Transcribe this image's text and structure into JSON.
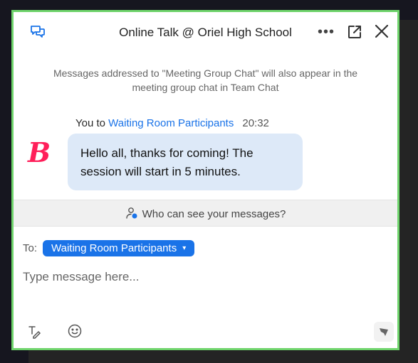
{
  "header": {
    "title": "Online Talk @ Oriel High School",
    "more_label": "•••"
  },
  "notice": "Messages addressed to \"Meeting Group Chat\" will also appear in the meeting group chat in Team Chat",
  "message": {
    "sender": "You to ",
    "recipient": "Waiting Room Participants",
    "time": "20:32",
    "avatar_letter": "B",
    "text": "Hello all, thanks for coming! The session will start in 5 minutes."
  },
  "visibility": {
    "label": "Who can see your messages?"
  },
  "composer": {
    "to_label": "To:",
    "recipient": "Waiting Room Participants",
    "caret": "▾",
    "placeholder": "Type message here..."
  },
  "colors": {
    "accent": "#1a73e8",
    "border": "#6fd46c",
    "avatar": "#ff1f5a",
    "bubble": "#dde9f8"
  },
  "icons": [
    "chat-bubbles-icon",
    "more-icon",
    "popout-icon",
    "close-icon",
    "person-visibility-icon",
    "format-text-icon",
    "emoji-icon",
    "send-icon"
  ]
}
